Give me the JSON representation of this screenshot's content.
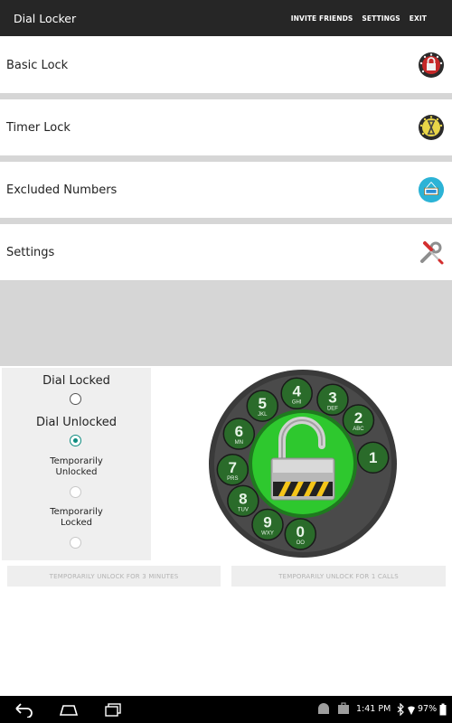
{
  "app_title": "Dial Locker",
  "actions": [
    "INVITE FRIENDS",
    "SETTINGS",
    "EXIT"
  ],
  "menu": [
    {
      "label": "Basic Lock",
      "icon": "red-lock-dial-icon"
    },
    {
      "label": "Timer Lock",
      "icon": "timer-dial-icon"
    },
    {
      "label": "Excluded Numbers",
      "icon": "open-sign-icon"
    },
    {
      "label": "Settings",
      "icon": "wrench-screwdriver-icon"
    }
  ],
  "options": {
    "dial_locked": "Dial Locked",
    "dial_unlocked": "Dial Unlocked",
    "temp_unlocked": "Temporarily Unlocked",
    "temp_locked": "Temporarily Locked",
    "selected": "Dial Unlocked"
  },
  "buttons": {
    "unlock_minutes": "TEMPORARILY UNLOCK FOR 3 MINUTES",
    "unlock_calls": "TEMPORARILY UNLOCK FOR 1 CALLS"
  },
  "dial": {
    "digits": [
      {
        "n": "1",
        "letters": ""
      },
      {
        "n": "2",
        "letters": "ABC"
      },
      {
        "n": "3",
        "letters": "DEF"
      },
      {
        "n": "4",
        "letters": "GHI"
      },
      {
        "n": "5",
        "letters": "JKL"
      },
      {
        "n": "6",
        "letters": "MN"
      },
      {
        "n": "7",
        "letters": "PRS"
      },
      {
        "n": "8",
        "letters": "TUV"
      },
      {
        "n": "9",
        "letters": "WXY"
      },
      {
        "n": "0",
        "letters": "OO"
      }
    ],
    "colors": {
      "ring": "#3a3a3a",
      "center": "#2ec82e",
      "hole": "#2a6b2a"
    }
  },
  "status": {
    "time": "1:41 PM",
    "battery": "97%"
  },
  "colors": {
    "accent": "#0e8c80",
    "action_bar": "#262626",
    "separator": "#d6d6d6"
  }
}
